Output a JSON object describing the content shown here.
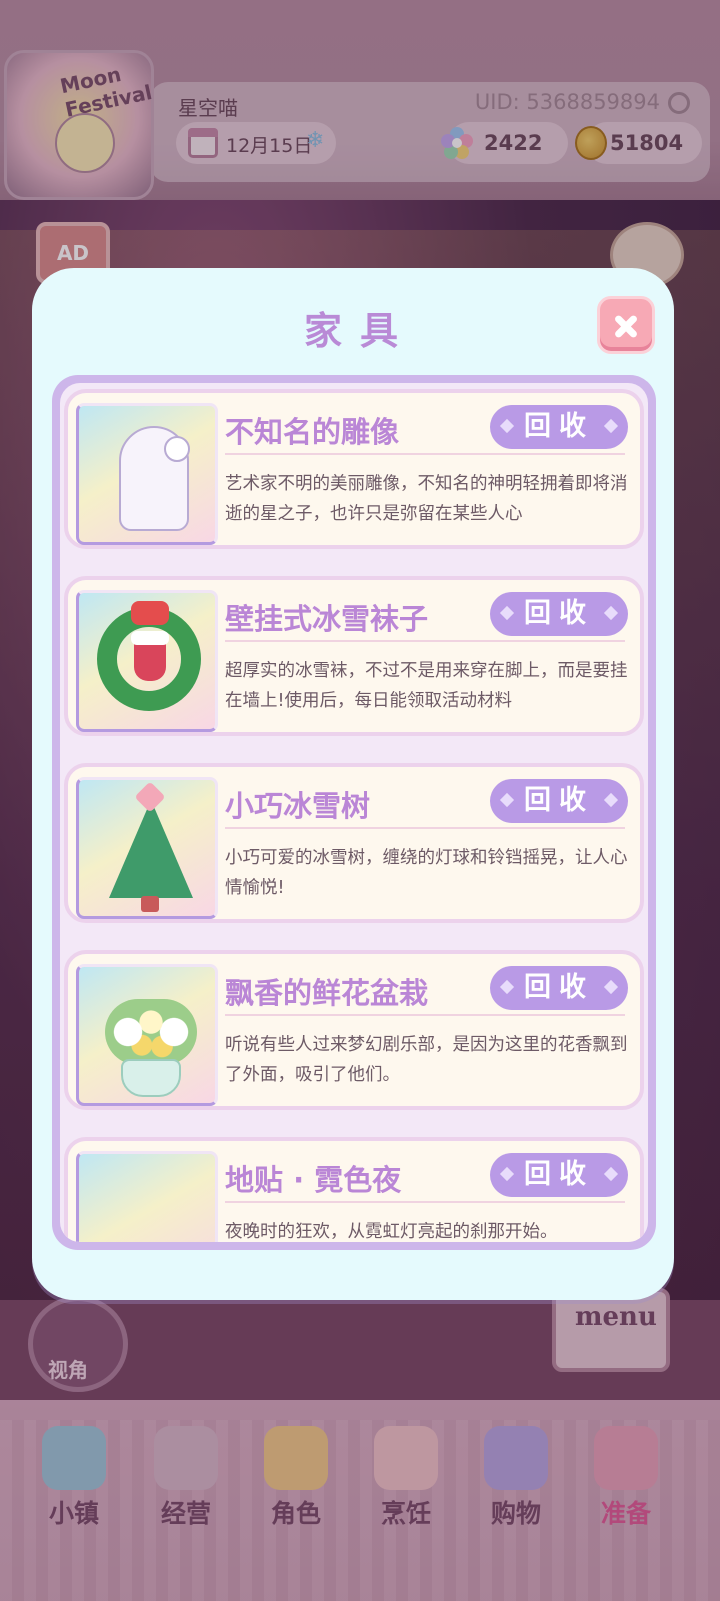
{
  "header": {
    "username": "星空喵",
    "uid": "UID: 5368859894",
    "date": "12月15日",
    "gems": "2422",
    "coins": "51804",
    "avatar_text": "Moon Festival"
  },
  "side_buttons": {
    "ad_label": "AD",
    "camera_label": "视角",
    "menu_label": "menu"
  },
  "modal": {
    "title": "家具",
    "recycle_label": "回收",
    "items": [
      {
        "name": "不知名的雕像",
        "description": "艺术家不明的美丽雕像，不知名的神明轻拥着即将消逝的星之子，也许只是弥留在某些人心"
      },
      {
        "name": "壁挂式冰雪袜子",
        "description": "超厚实的冰雪袜，不过不是用来穿在脚上，而是要挂在墙上!使用后，每日能领取活动材料"
      },
      {
        "name": "小巧冰雪树",
        "description": "小巧可爱的冰雪树，缠绕的灯球和铃铛摇晃，让人心情愉悦!"
      },
      {
        "name": "飘香的鲜花盆栽",
        "description": "听说有些人过来梦幻剧乐部，是因为这里的花香飘到了外面，吸引了他们。"
      },
      {
        "name": "地贴 · 霓色夜",
        "description": "夜晚时的狂欢，从霓虹灯亮起的刹那开始。"
      }
    ]
  },
  "bottom_nav": [
    {
      "label": "小镇",
      "icon": "map-icon",
      "color": "#9fc6d9"
    },
    {
      "label": "经营",
      "icon": "shop-bag-icon",
      "color": "#d7b7c9"
    },
    {
      "label": "角色",
      "icon": "character-icon",
      "color": "#f0c98a"
    },
    {
      "label": "烹饪",
      "icon": "cake-icon",
      "color": "#f1c3c9"
    },
    {
      "label": "购物",
      "icon": "shopping-bag-icon",
      "color": "#b9a6e0"
    },
    {
      "label": "准备",
      "icon": "basket-icon",
      "color": "#e7a0b8",
      "active": true
    }
  ],
  "colors": {
    "accent": "#b99ae6",
    "title": "#b98ad6",
    "close": "#f7a9b5",
    "active_nav": "#e15b97"
  }
}
